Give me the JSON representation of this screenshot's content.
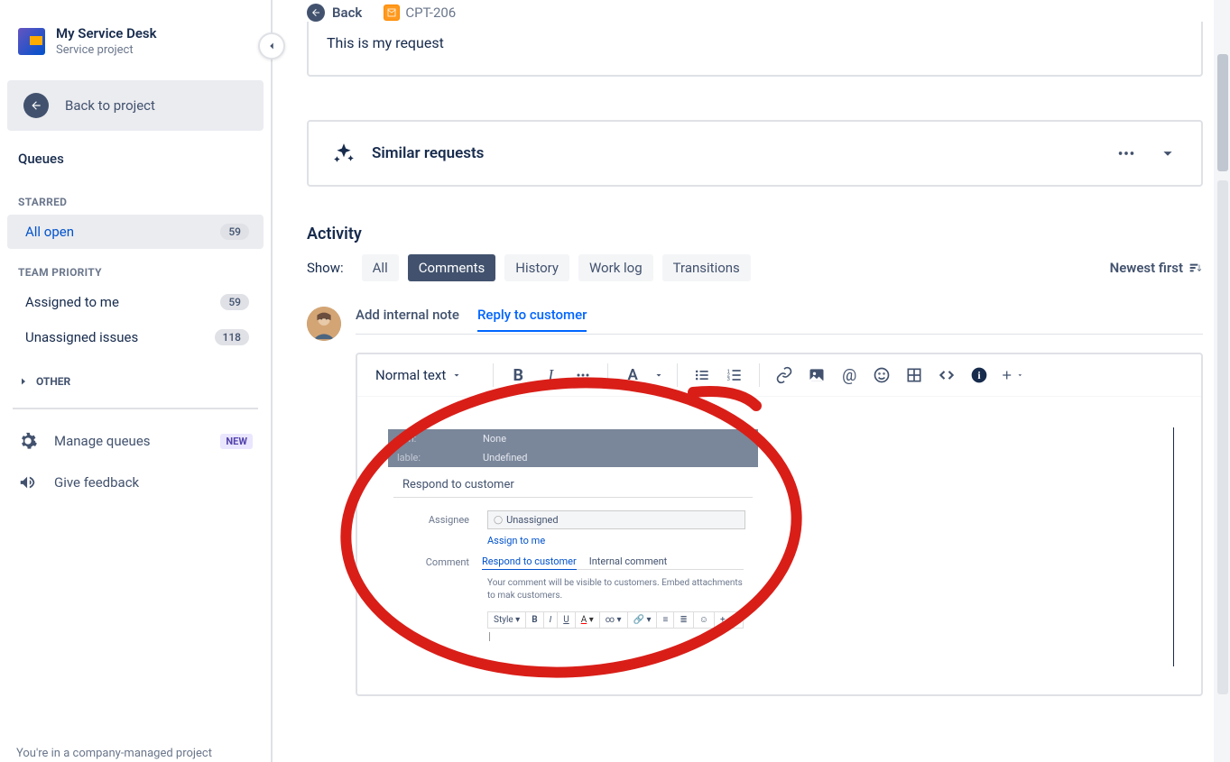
{
  "project": {
    "title": "My Service Desk",
    "subtitle": "Service project"
  },
  "back_to_project": "Back to project",
  "queues": "Queues",
  "sections": {
    "starred": "STARRED",
    "team_priority": "TEAM PRIORITY",
    "other": "OTHER"
  },
  "sidebar": {
    "all_open": {
      "label": "All open",
      "count": "59"
    },
    "assigned_me": {
      "label": "Assigned to me",
      "count": "59"
    },
    "unassigned": {
      "label": "Unassigned issues",
      "count": "118"
    }
  },
  "manage_queues": "Manage queues",
  "new_badge": "NEW",
  "give_feedback": "Give feedback",
  "footer": "You're in a company-managed project",
  "back": "Back",
  "issue_key": "CPT-206",
  "request_text": "This is my request",
  "similar": "Similar requests",
  "activity": "Activity",
  "show": "Show:",
  "tabs": {
    "all": "All",
    "comments": "Comments",
    "history": "History",
    "worklog": "Work log",
    "transitions": "Transitions"
  },
  "sort": "Newest first",
  "comment_tabs": {
    "internal": "Add internal note",
    "reply": "Reply to customer"
  },
  "text_style": "Normal text",
  "embedded": {
    "row1_key": "tion:",
    "row1_val": "None",
    "row2_key": "lable:",
    "row2_val": "Undefined",
    "heading": "Respond to customer",
    "assignee_label": "Assignee",
    "assignee_value": "Unassigned",
    "assign_link": "Assign to me",
    "comment_label": "Comment",
    "tab_respond": "Respond to customer",
    "tab_internal": "Internal comment",
    "desc": "Your comment will be visible to customers. Embed attachments to mak customers.",
    "style": "Style"
  }
}
